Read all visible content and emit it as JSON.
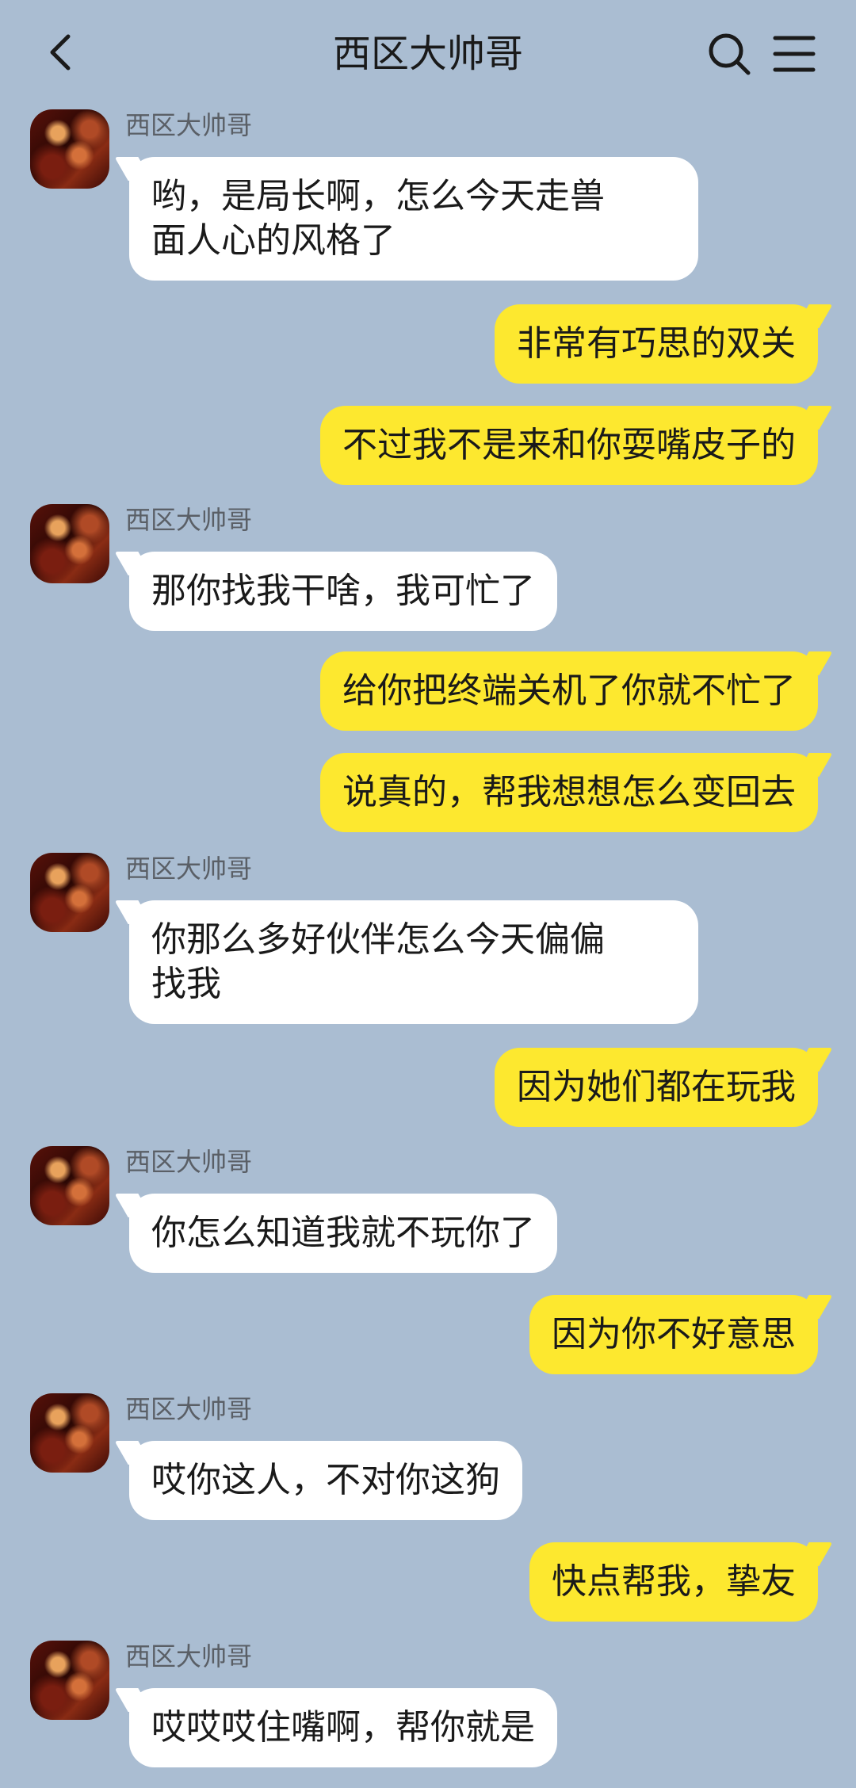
{
  "header": {
    "title": "西区大帅哥",
    "back_icon": "chevron-left-icon",
    "search_icon": "search-icon",
    "menu_icon": "menu-icon"
  },
  "colors": {
    "background": "#aabdd2",
    "incoming_bubble": "#ffffff",
    "outgoing_bubble": "#fde82f"
  },
  "messages": [
    {
      "side": "in",
      "sender": "西区大帅哥",
      "text": "哟，是局长啊，怎么今天走兽\n面人心的风格了"
    },
    {
      "side": "out",
      "text": "非常有巧思的双关"
    },
    {
      "side": "out",
      "text": "不过我不是来和你耍嘴皮子的"
    },
    {
      "side": "in",
      "sender": "西区大帅哥",
      "text": "那你找我干啥，我可忙了"
    },
    {
      "side": "out",
      "text": "给你把终端关机了你就不忙了"
    },
    {
      "side": "out",
      "text": "说真的，帮我想想怎么变回去"
    },
    {
      "side": "in",
      "sender": "西区大帅哥",
      "text": "你那么多好伙伴怎么今天偏偏\n找我"
    },
    {
      "side": "out",
      "text": "因为她们都在玩我"
    },
    {
      "side": "in",
      "sender": "西区大帅哥",
      "text": "你怎么知道我就不玩你了"
    },
    {
      "side": "out",
      "text": "因为你不好意思"
    },
    {
      "side": "in",
      "sender": "西区大帅哥",
      "text": "哎你这人，不对你这狗"
    },
    {
      "side": "out",
      "text": "快点帮我，挚友"
    },
    {
      "side": "in",
      "sender": "西区大帅哥",
      "text": "哎哎哎住嘴啊，帮你就是"
    }
  ]
}
